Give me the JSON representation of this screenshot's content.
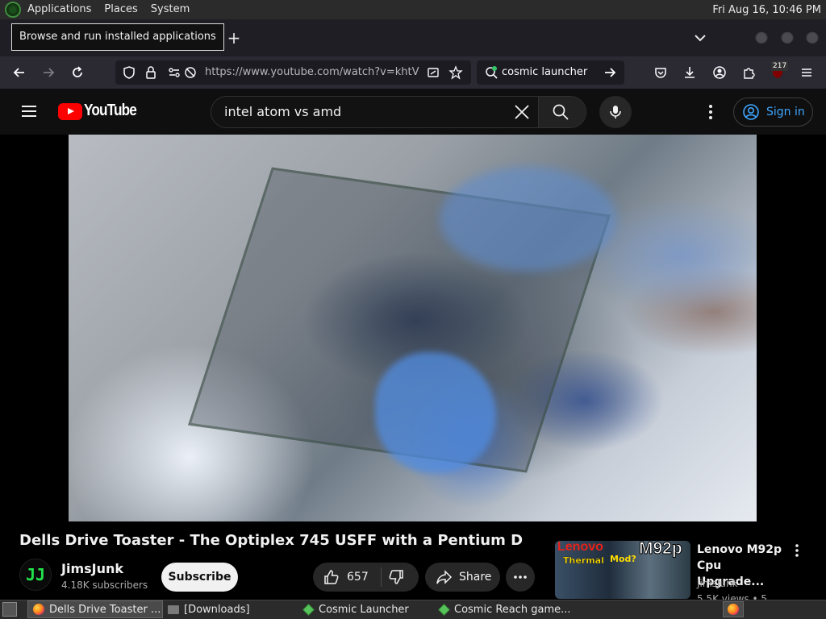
{
  "top_panel": {
    "menus": [
      "Applications",
      "Places",
      "System"
    ],
    "clock": "Fri Aug 16, 10:46 PM"
  },
  "firefox": {
    "tooltip": "Browse and run installed applications",
    "new_tab": "+",
    "url": "https://www.youtube.com/watch?v=khtVl...",
    "search_text": "cosmic launcher",
    "extension_badge": "217"
  },
  "youtube": {
    "logo_text": "YouTube",
    "search_query": "intel atom vs amd",
    "signin_label": "Sign in",
    "video_title": "Dells Drive Toaster - The Optiplex 745 USFF with a Pentium D",
    "channel": {
      "avatar_text": "JJ",
      "name": "JimsJunk",
      "subscribers": "4.18K subscribers"
    },
    "subscribe_label": "Subscribe",
    "like_count": "657",
    "share_label": "Share",
    "recommended": {
      "thumb_brand": "Lenovo",
      "thumb_model": "M92p",
      "thumb_text1": "Thermal",
      "thumb_text2": "Mod?",
      "title": "Lenovo M92p Cpu Upgrade...",
      "channel": "JimsJunk",
      "views": "5.5K views • 5"
    }
  },
  "taskbar": {
    "tasks": [
      {
        "label": "Dells Drive Toaster ...",
        "icon": "firefox-icon",
        "active": true
      },
      {
        "label": "[Downloads]",
        "icon": "folder-icon",
        "active": false
      },
      {
        "label": "Cosmic Launcher",
        "icon": "cube-icon",
        "active": false
      },
      {
        "label": "Cosmic Reach game...",
        "icon": "cube-icon",
        "active": false
      }
    ]
  },
  "colors": {
    "youtube_red": "#ff0000",
    "signin_blue": "#3ea6ff",
    "panel_bg": "#2b2b2b",
    "browser_bg": "#2b2a33"
  }
}
